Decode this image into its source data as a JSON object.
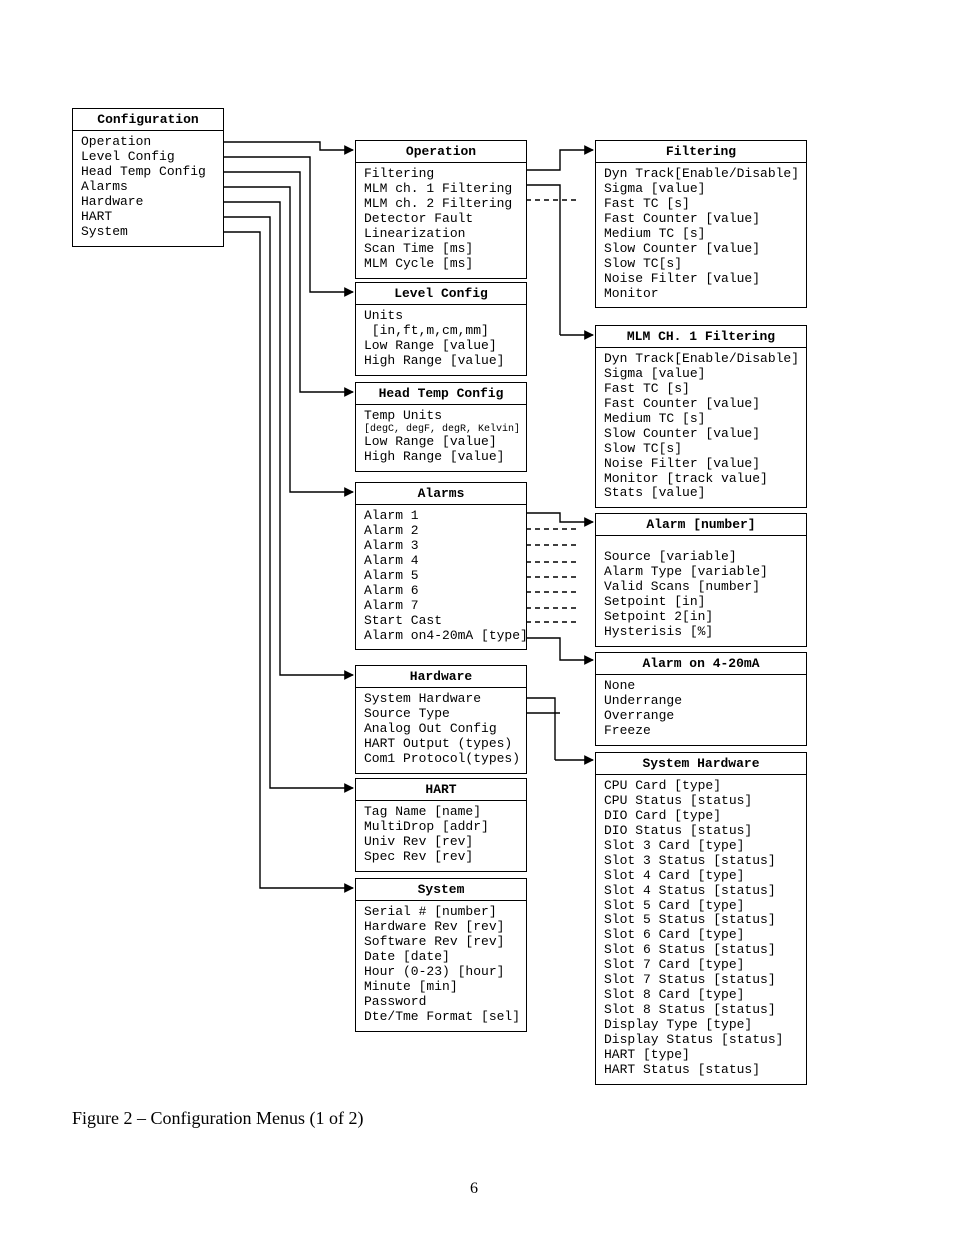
{
  "caption": "Figure 2 – Configuration Menus (1 of 2)",
  "page_number": "6",
  "col1": {
    "config": {
      "title": "Configuration",
      "items": [
        "Operation",
        "Level Config",
        "Head Temp Config",
        "Alarms",
        "Hardware",
        "HART",
        "System"
      ]
    }
  },
  "col2": {
    "operation": {
      "title": "Operation",
      "items": [
        "Filtering",
        "MLM ch. 1 Filtering",
        "MLM ch. 2 Filtering",
        "Detector Fault",
        "Linearization",
        "Scan Time [ms]",
        "MLM Cycle [ms]"
      ]
    },
    "level": {
      "title": "Level Config",
      "items": [
        "Units",
        " [in,ft,m,cm,mm]",
        "Low Range [value]",
        "High Range [value]"
      ]
    },
    "headtemp": {
      "title": "Head Temp Config",
      "items": [
        "Temp Units",
        "[degC, degF, degR, Kelvin]",
        "Low Range [value]",
        "High Range [value]"
      ]
    },
    "alarms": {
      "title": "Alarms",
      "items": [
        "Alarm 1",
        "Alarm 2",
        "Alarm 3",
        "Alarm 4",
        "Alarm 5",
        "Alarm 6",
        "Alarm 7",
        "Start Cast",
        "Alarm on4-20mA [type]"
      ]
    },
    "hardware": {
      "title": "Hardware",
      "items": [
        "System Hardware",
        "Source Type",
        "Analog Out Config",
        "HART Output (types)",
        "Com1 Protocol(types)"
      ]
    },
    "hart": {
      "title": "HART",
      "items": [
        "Tag Name [name]",
        "MultiDrop [addr]",
        "Univ Rev [rev]",
        "Spec Rev [rev]"
      ]
    },
    "system": {
      "title": "System",
      "items": [
        "Serial # [number]",
        "Hardware Rev [rev]",
        "Software Rev [rev]",
        "Date [date]",
        "Hour (0-23) [hour]",
        "Minute [min]",
        "Password",
        "Dte/Tme Format [sel]"
      ]
    }
  },
  "col3": {
    "filtering": {
      "title": "Filtering",
      "items": [
        "Dyn Track[Enable/Disable]",
        "Sigma [value]",
        "Fast TC [s]",
        "Fast Counter [value]",
        "Medium TC [s]",
        "Slow Counter [value]",
        "Slow TC[s]",
        "Noise Filter [value]",
        "Monitor"
      ]
    },
    "mlm1": {
      "title": "MLM CH. 1 Filtering",
      "items": [
        "Dyn Track[Enable/Disable]",
        "Sigma [value]",
        "Fast TC [s]",
        "Fast Counter [value]",
        "Medium TC [s]",
        "Slow Counter [value]",
        "Slow TC[s]",
        "Noise Filter [value]",
        "Monitor [track value]",
        "Stats [value]"
      ]
    },
    "alarmnum": {
      "title": "Alarm [number]",
      "items": [
        "Source [variable]",
        "Alarm Type [variable]",
        "Valid Scans [number]",
        "Setpoint [in]",
        "Setpoint 2[in]",
        "Hysterisis [%]"
      ]
    },
    "alarm420": {
      "title": "Alarm on 4-20mA",
      "items": [
        "None",
        "Underrange",
        "Overrange",
        "Freeze"
      ]
    },
    "syshw": {
      "title": "System Hardware",
      "items": [
        "CPU Card [type]",
        "CPU Status [status]",
        "DIO Card [type]",
        "DIO Status [status]",
        "Slot 3 Card [type]",
        "Slot 3 Status [status]",
        "Slot 4 Card [type]",
        "Slot 4 Status [status]",
        "Slot 5 Card [type]",
        "Slot 5 Status [status]",
        "Slot 6 Card [type]",
        "Slot 6 Status [status]",
        "Slot 7 Card [type]",
        "Slot 7 Status [status]",
        "Slot 8 Card [type]",
        "Slot 8 Status [status]",
        "Display Type [type]",
        "Display Status [status]",
        "HART [type]",
        "HART Status [status]"
      ]
    }
  }
}
